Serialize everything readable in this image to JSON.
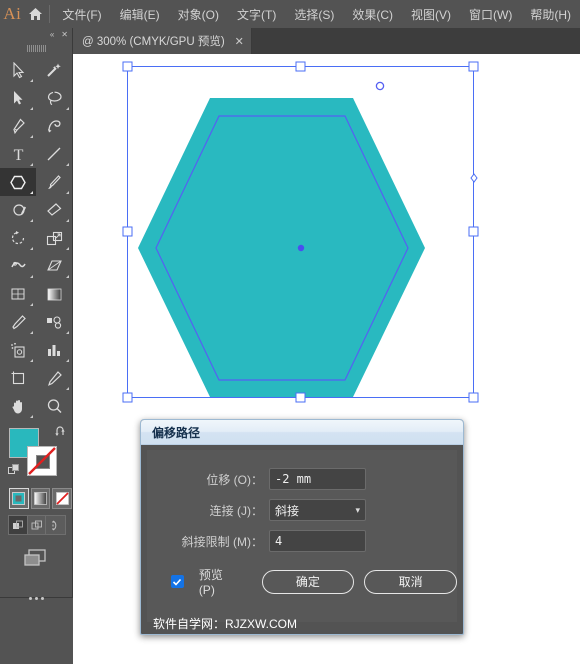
{
  "app": {
    "logo_text": "Ai",
    "home_icon": "home-icon"
  },
  "menubar": {
    "items": [
      {
        "label": "文件(F)"
      },
      {
        "label": "编辑(E)"
      },
      {
        "label": "对象(O)"
      },
      {
        "label": "文字(T)"
      },
      {
        "label": "选择(S)"
      },
      {
        "label": "效果(C)"
      },
      {
        "label": "视图(V)"
      },
      {
        "label": "窗口(W)"
      },
      {
        "label": "帮助(H)"
      }
    ]
  },
  "tabbar": {
    "tab_label": "@ 300% (CMYK/GPU 预览)",
    "close_glyph": "✕"
  },
  "toolpanel": {
    "collapse_glyph": "«",
    "close_glyph": "✕",
    "tools": [
      {
        "name": "selection-tool",
        "active": false
      },
      {
        "name": "magic-wand-tool",
        "active": false
      },
      {
        "name": "direct-selection-tool",
        "active": false
      },
      {
        "name": "lasso-tool",
        "active": false
      },
      {
        "name": "pen-tool",
        "active": false
      },
      {
        "name": "curvature-tool",
        "active": false
      },
      {
        "name": "type-tool",
        "active": false
      },
      {
        "name": "line-segment-tool",
        "active": false
      },
      {
        "name": "polygon-shape-tool",
        "active": true
      },
      {
        "name": "paintbrush-tool",
        "active": false
      },
      {
        "name": "shaper-pencil-tool",
        "active": false
      },
      {
        "name": "eraser-tool",
        "active": false
      },
      {
        "name": "rotate-tool",
        "active": false
      },
      {
        "name": "scale-tool",
        "active": false
      },
      {
        "name": "width-tool",
        "active": false
      },
      {
        "name": "free-transform-tool",
        "active": false
      },
      {
        "name": "shape-builder-tool",
        "active": false
      },
      {
        "name": "gradient-tool",
        "active": false
      },
      {
        "name": "eyedropper-tool",
        "active": false
      },
      {
        "name": "blend-tool",
        "active": false
      },
      {
        "name": "symbol-sprayer-tool",
        "active": false
      },
      {
        "name": "column-graph-tool",
        "active": false
      },
      {
        "name": "artboard-tool",
        "active": false
      },
      {
        "name": "slice-tool",
        "active": false
      },
      {
        "name": "hand-tool",
        "active": false
      },
      {
        "name": "zoom-tool",
        "active": false
      }
    ],
    "fill_color": "#29b8bd",
    "stroke_color": "#ffffff",
    "stroke_none": true,
    "paint_modes": [
      {
        "name": "color-mode-button",
        "selected": true
      },
      {
        "name": "gradient-mode-button",
        "selected": false
      },
      {
        "name": "none-mode-button",
        "selected": false
      }
    ],
    "draw_modes": [
      {
        "name": "draw-normal-button",
        "selected": true
      },
      {
        "name": "draw-behind-button",
        "selected": false
      },
      {
        "name": "draw-inside-button",
        "selected": false
      }
    ],
    "more_tools_label": "•••"
  },
  "canvas": {
    "background": "#ffffff",
    "shape_fill": "#29b9c0",
    "selection_color": "#4a6ef5",
    "offset_path_color": "#5560f2",
    "handle_fill": "#ffffff",
    "center_point_color": "#4a4ef0",
    "zoom_level": "300%"
  },
  "dialog": {
    "title": "偏移路径",
    "fields": [
      {
        "label": "位移 (O)：",
        "value": "-2 mm",
        "type": "text"
      },
      {
        "label": "连接 (J)：",
        "value": "斜接",
        "type": "select"
      },
      {
        "label": "斜接限制 (M)：",
        "value": "4",
        "type": "text"
      }
    ],
    "preview": {
      "label": "预览 (P)",
      "checked": true,
      "check_glyph": "✓"
    },
    "ok_label": "确定",
    "cancel_label": "取消",
    "watermark": "软件自学网：RJZXW.COM"
  }
}
